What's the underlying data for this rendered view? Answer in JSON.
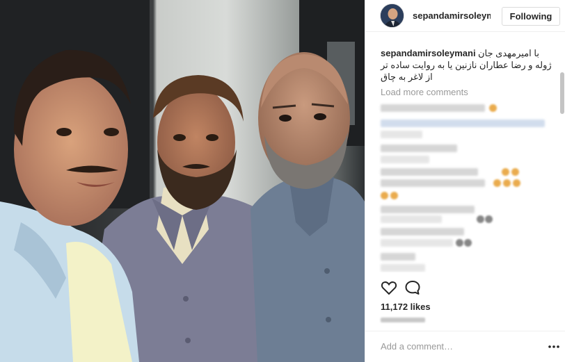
{
  "header": {
    "username": "sepandamirsoleymani",
    "follow_label": "Following"
  },
  "caption": {
    "username": "sepandamirsoleymani",
    "lines": [
      "با امیرمهدی جان",
      "ژوله و رضا عطاران نازنین یا به روایت ساده تر",
      "از لاغر به چاق"
    ]
  },
  "comments": {
    "load_more_label": "Load more comments"
  },
  "post": {
    "likes": "11,172 likes"
  },
  "comment_box": {
    "placeholder": "Add a comment…"
  },
  "icons": {
    "like": "heart-icon",
    "comment": "speech-bubble-icon",
    "more": "ellipsis-icon"
  },
  "colors": {
    "follow_text": "#262626",
    "muted_text": "#999999",
    "divider": "#efefef"
  }
}
